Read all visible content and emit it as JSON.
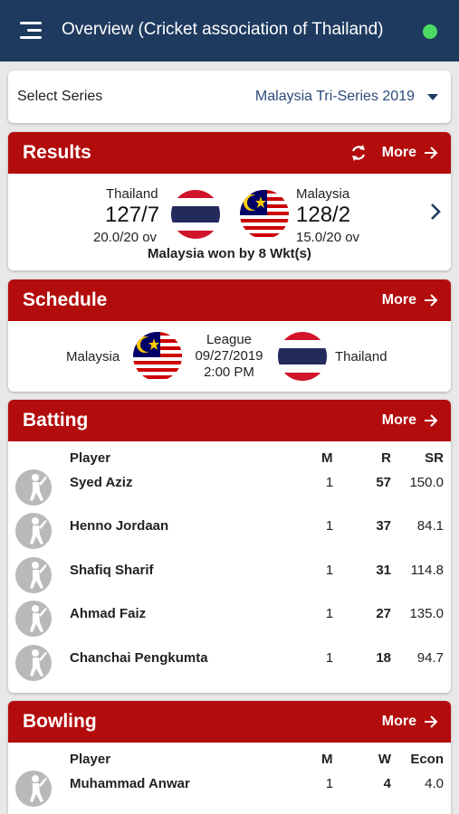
{
  "header": {
    "title": "Overview (Cricket association of Thailand)",
    "status_color": "#4cd964"
  },
  "series": {
    "label": "Select Series",
    "selected": "Malaysia Tri-Series 2019"
  },
  "results": {
    "title": "Results",
    "more": "More",
    "team1": {
      "name": "Thailand",
      "score": "127/7",
      "overs": "20.0/20 ov",
      "flag": "thailand-flag-icon"
    },
    "team2": {
      "name": "Malaysia",
      "score": "128/2",
      "overs": "15.0/20 ov",
      "flag": "malaysia-flag-icon"
    },
    "summary": "Malaysia won by 8 Wkt(s)"
  },
  "schedule": {
    "title": "Schedule",
    "more": "More",
    "team1": "Malaysia",
    "team2": "Thailand",
    "stage": "League",
    "date": "09/27/2019",
    "time": "2:00 PM"
  },
  "batting": {
    "title": "Batting",
    "more": "More",
    "columns": {
      "player": "Player",
      "m": "M",
      "r": "R",
      "sr": "SR"
    },
    "rows": [
      {
        "name": "Syed Aziz",
        "m": "1",
        "r": "57",
        "sr": "150.0"
      },
      {
        "name": "Henno Jordaan",
        "m": "1",
        "r": "37",
        "sr": "84.1"
      },
      {
        "name": "Shafiq Sharif",
        "m": "1",
        "r": "31",
        "sr": "114.8"
      },
      {
        "name": "Ahmad Faiz",
        "m": "1",
        "r": "27",
        "sr": "135.0"
      },
      {
        "name": "Chanchai Pengkumta",
        "m": "1",
        "r": "18",
        "sr": "94.7"
      }
    ]
  },
  "bowling": {
    "title": "Bowling",
    "more": "More",
    "columns": {
      "player": "Player",
      "m": "M",
      "w": "W",
      "econ": "Econ"
    },
    "rows": [
      {
        "name": "Muhammad Anwar",
        "m": "1",
        "w": "4",
        "econ": "4.0"
      }
    ]
  },
  "colors": {
    "header_bg": "#1e3a5f",
    "section_red": "#b30c0c",
    "series_text": "#2c4a7a"
  }
}
